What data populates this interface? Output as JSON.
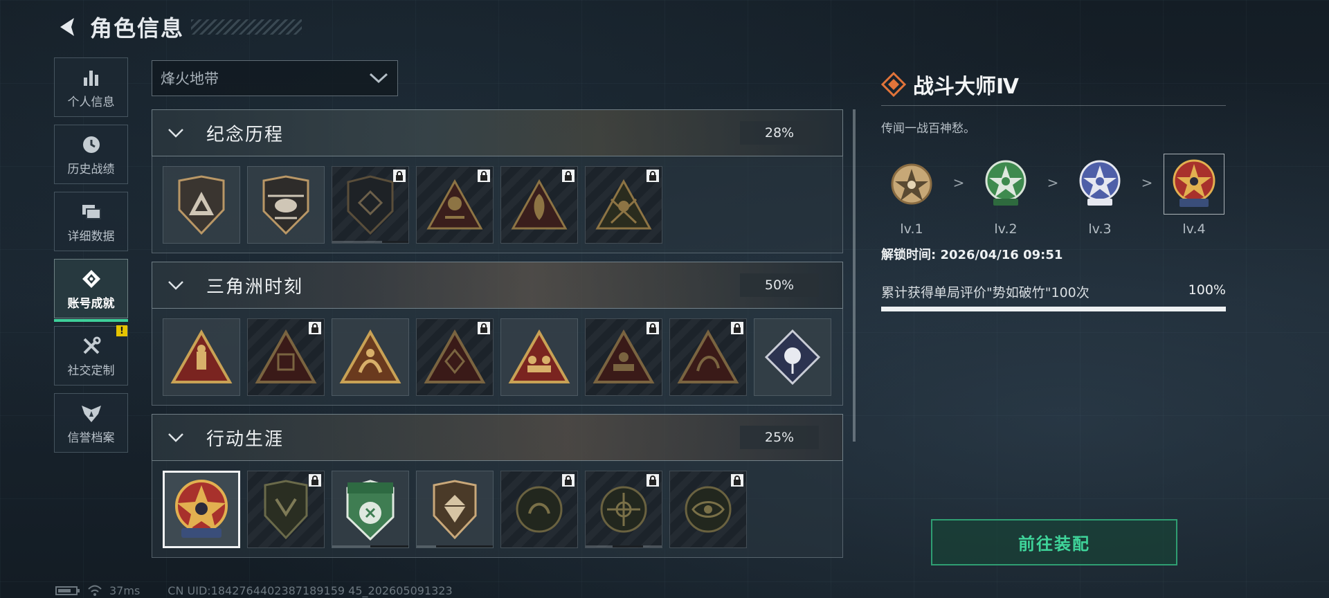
{
  "header": {
    "title": "角色信息"
  },
  "sidebar": {
    "items": [
      {
        "label": "个人信息",
        "icon": "bar-chart-icon"
      },
      {
        "label": "历史战绩",
        "icon": "clock-icon"
      },
      {
        "label": "详细数据",
        "icon": "folder-icon"
      },
      {
        "label": "账号成就",
        "icon": "diamond-badge-icon",
        "active": true
      },
      {
        "label": "社交定制",
        "icon": "tools-icon",
        "badge": "!"
      },
      {
        "label": "信誉档案",
        "icon": "shield-wings-icon"
      }
    ]
  },
  "filter": {
    "selected": "烽火地带"
  },
  "sections": [
    {
      "name": "纪念历程",
      "percent": "28%"
    },
    {
      "name": "三角洲时刻",
      "percent": "50%"
    },
    {
      "name": "行动生涯",
      "percent": "25%"
    }
  ],
  "detail": {
    "title": "战斗大师Ⅳ",
    "description": "传闻一战百神愁。",
    "levels": [
      "lv.1",
      "lv.2",
      "lv.3",
      "lv.4"
    ],
    "arrow": ">",
    "unlock_text": "解锁时间: 2026/04/16 09:51",
    "requirement": "累计获得单局评价\"势如破竹\"100次",
    "requirement_percent": "100%",
    "progress_fraction": 1.0
  },
  "equip_button": "前往装配",
  "status": {
    "ping": "37ms",
    "uid": "CN UID:1842764402387189159 45_202605091323"
  },
  "colors": {
    "accent": "#3fd09a",
    "badge": "#e6c400",
    "brand_orange": "#e2743a"
  }
}
